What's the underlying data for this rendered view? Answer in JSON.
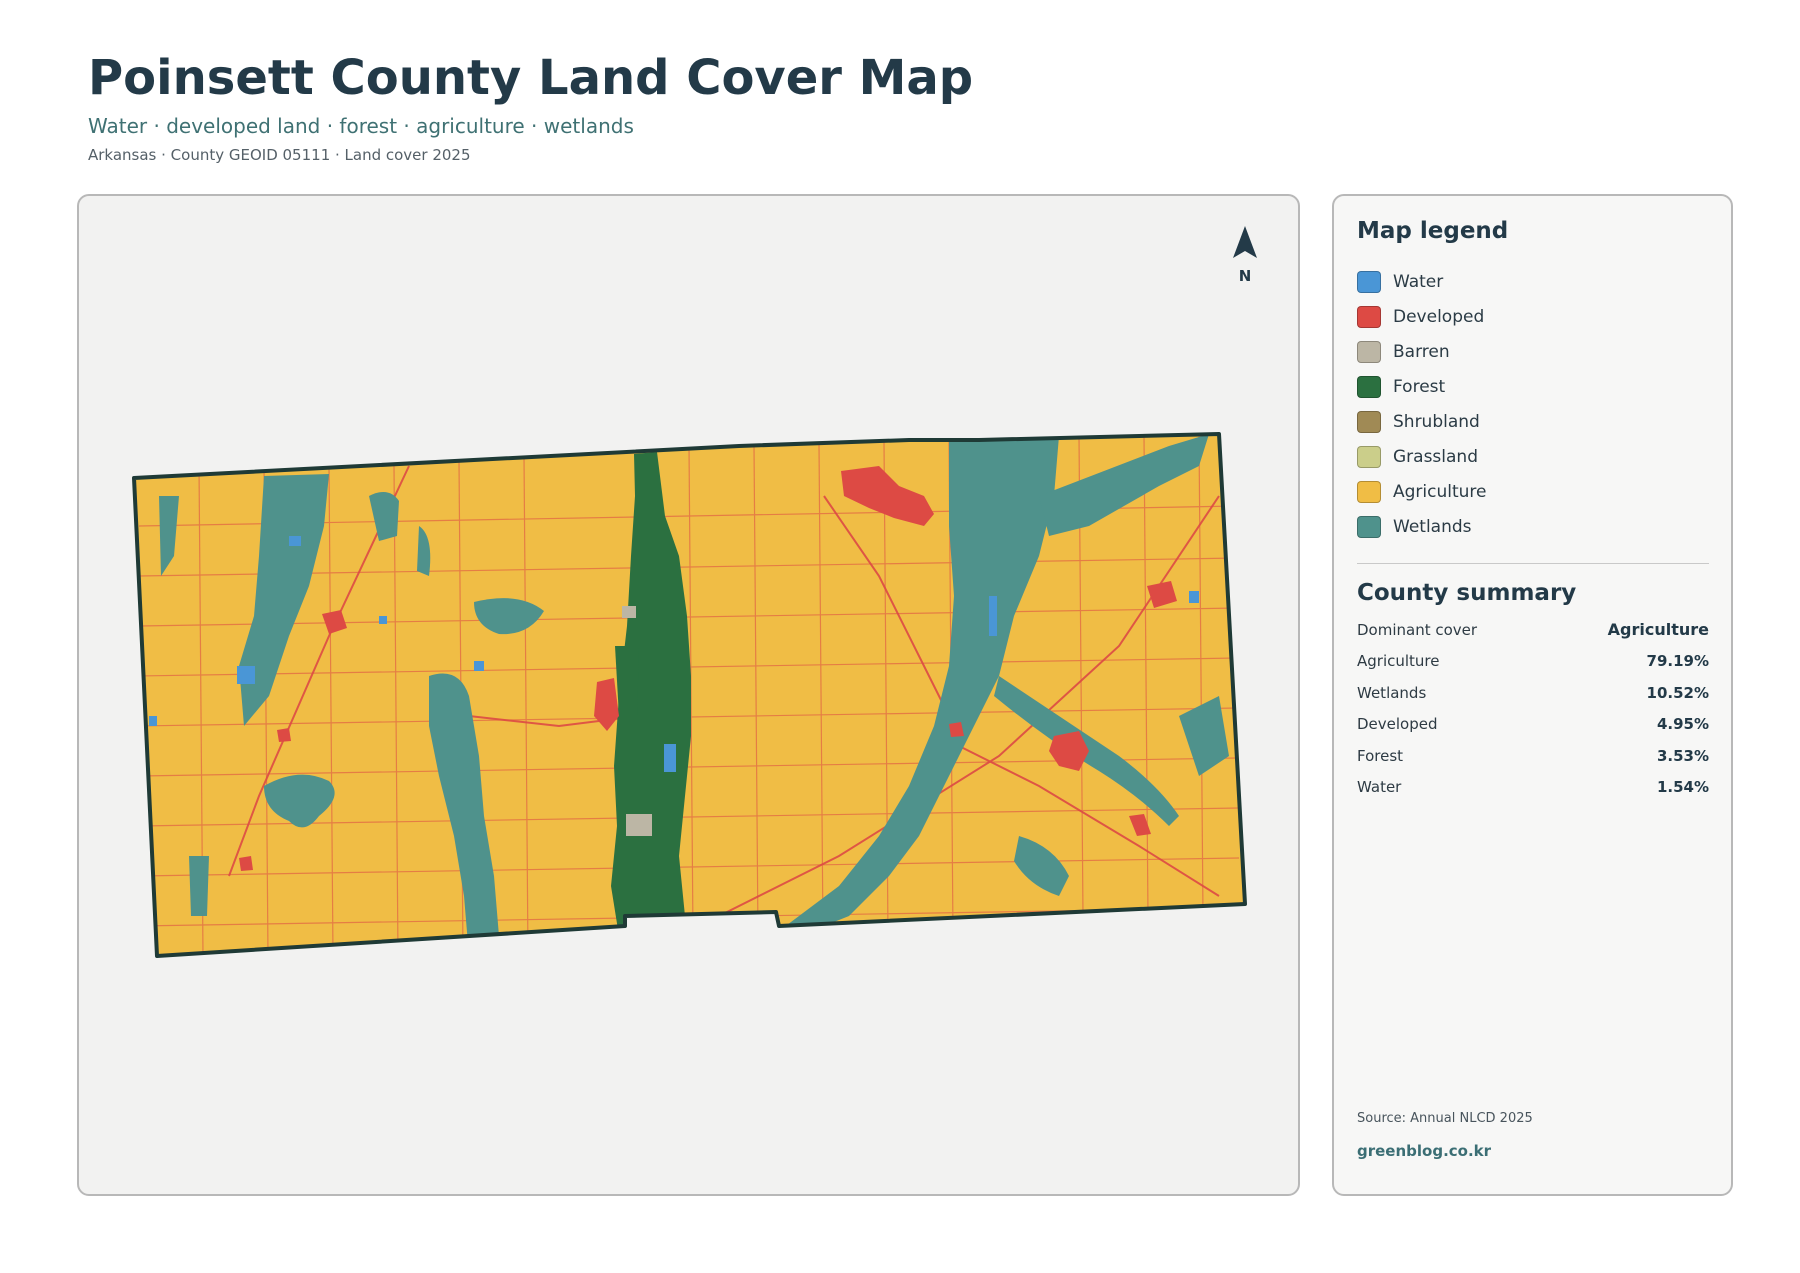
{
  "header": {
    "title": "Poinsett County Land Cover Map",
    "subtitle": "Water · developed land · forest · agriculture · wetlands",
    "meta": "Arkansas · County GEOID 05111 · Land cover 2025"
  },
  "map": {
    "north_label": "N",
    "colors": {
      "water": "#4a96d6",
      "developed": "#dd4a44",
      "barren": "#bcb6a5",
      "forest": "#2b7040",
      "shrubland": "#a08a55",
      "grassland": "#cbce8a",
      "agriculture": "#f0bd45",
      "wetlands": "#4f928c",
      "boundary": "#1f3a36",
      "panel_bg": "#f2f2f1"
    }
  },
  "legend": {
    "title": "Map legend",
    "items": [
      {
        "label": "Water",
        "color": "#4a96d6"
      },
      {
        "label": "Developed",
        "color": "#dd4a44"
      },
      {
        "label": "Barren",
        "color": "#bcb6a5"
      },
      {
        "label": "Forest",
        "color": "#2b7040"
      },
      {
        "label": "Shrubland",
        "color": "#a08a55"
      },
      {
        "label": "Grassland",
        "color": "#cbce8a"
      },
      {
        "label": "Agriculture",
        "color": "#f0bd45"
      },
      {
        "label": "Wetlands",
        "color": "#4f928c"
      }
    ]
  },
  "summary": {
    "title": "County summary",
    "dominant_label": "Dominant cover",
    "dominant_value": "Agriculture",
    "rows": [
      {
        "label": "Agriculture",
        "value": "79.19%"
      },
      {
        "label": "Wetlands",
        "value": "10.52%"
      },
      {
        "label": "Developed",
        "value": "4.95%"
      },
      {
        "label": "Forest",
        "value": "3.53%"
      },
      {
        "label": "Water",
        "value": "1.54%"
      }
    ]
  },
  "footer": {
    "source": "Source: Annual NLCD 2025",
    "brand": "greenblog.co.kr"
  }
}
